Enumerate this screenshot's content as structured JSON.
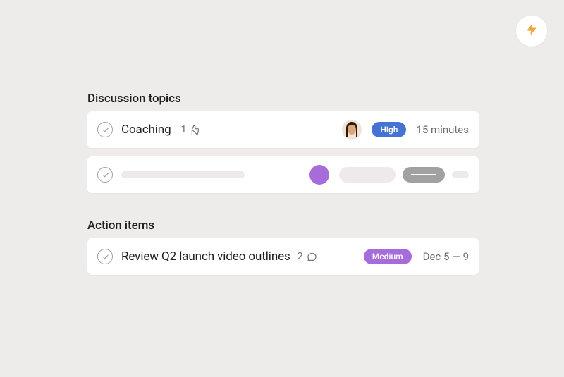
{
  "badge": {
    "icon_name": "lightning-icon"
  },
  "sections": {
    "discussion": {
      "header": "Discussion topics",
      "items": [
        {
          "title": "Coaching",
          "like_count": "1",
          "priority_label": "High",
          "duration": "15 minutes"
        }
      ]
    },
    "action": {
      "header": "Action items",
      "items": [
        {
          "title": "Review Q2 launch video outlines",
          "comment_count": "2",
          "priority_label": "Medium",
          "date_range": "Dec 5 — 9"
        }
      ]
    }
  }
}
